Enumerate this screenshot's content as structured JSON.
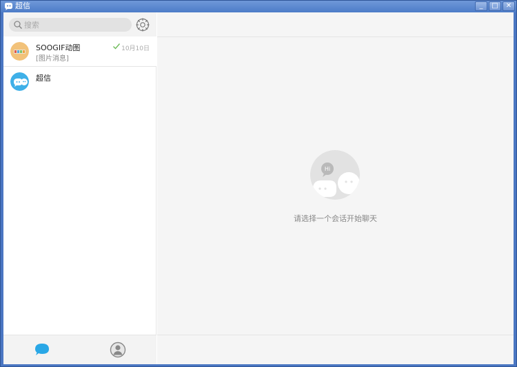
{
  "window": {
    "title": "超信",
    "minimize_glyph": "_",
    "maximize_glyph": "□",
    "close_glyph": "✕"
  },
  "search": {
    "placeholder": "搜索"
  },
  "conversations": [
    {
      "name": "SOOGIF动图",
      "preview": "[图片消息]",
      "time": "10月10日",
      "status_icon": "check-icon",
      "avatar_color": "#f2c27a"
    },
    {
      "name": "超信",
      "preview": "",
      "time": "",
      "avatar_color": "#3fb0e8"
    }
  ],
  "main": {
    "empty_message": "请选择一个会话开始聊天",
    "badge_text": "Hi"
  },
  "nav": {
    "chat_icon": "chat-bubble-icon",
    "contacts_icon": "contacts-icon"
  },
  "colors": {
    "accent": "#29a7e6",
    "titlebar": "#4a76c2",
    "panel_bg": "#f5f5f5"
  }
}
